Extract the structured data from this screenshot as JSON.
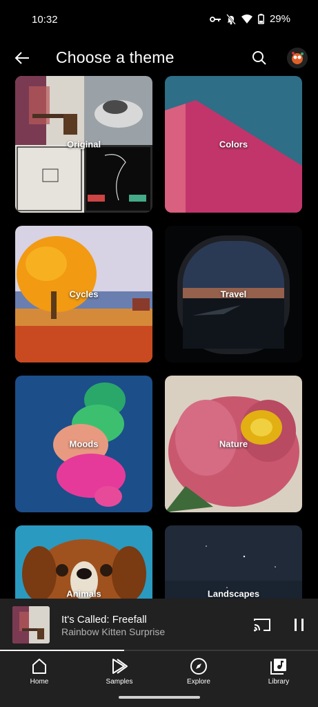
{
  "status": {
    "time": "10:32",
    "battery": "29%"
  },
  "header": {
    "title": "Choose a theme"
  },
  "themes": [
    {
      "label": "Original"
    },
    {
      "label": "Colors"
    },
    {
      "label": "Cycles"
    },
    {
      "label": "Travel"
    },
    {
      "label": "Moods"
    },
    {
      "label": "Nature"
    },
    {
      "label": "Animals"
    },
    {
      "label": "Landscapes"
    }
  ],
  "player": {
    "title": "It's Called: Freefall",
    "artist": "Rainbow Kitten Surprise",
    "progress": 0.39
  },
  "nav": {
    "items": [
      {
        "label": "Home",
        "icon": "home-icon"
      },
      {
        "label": "Samples",
        "icon": "samples-icon"
      },
      {
        "label": "Explore",
        "icon": "explore-icon"
      },
      {
        "label": "Library",
        "icon": "library-icon"
      }
    ]
  }
}
